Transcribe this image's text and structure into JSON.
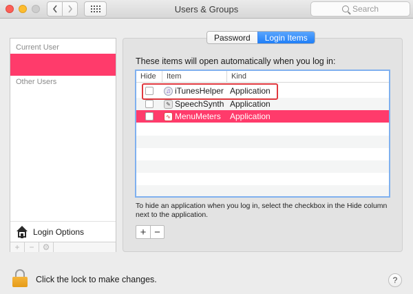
{
  "window": {
    "title": "Users & Groups",
    "search_placeholder": "Search",
    "back_icon": "chevron-left-icon",
    "forward_icon": "chevron-right-icon",
    "show_all_icon": "grid-icon"
  },
  "users_panel": {
    "current_user_header": "Current User",
    "other_users_header": "Other Users",
    "login_options_label": "Login Options",
    "footer_buttons": [
      "+",
      "−",
      "⚙"
    ]
  },
  "tabs": [
    {
      "label": "Password",
      "active": false
    },
    {
      "label": "Login Items",
      "active": true
    }
  ],
  "login_items": {
    "intro": "These items will open automatically when you log in:",
    "columns": {
      "hide": "Hide",
      "item": "Item",
      "kind": "Kind"
    },
    "rows": [
      {
        "name": "iTunesHelper",
        "kind": "Application",
        "hidden": false,
        "selected": false,
        "icon": "itunes-icon"
      },
      {
        "name": "SpeechSynth",
        "kind": "Application",
        "hidden": false,
        "selected": false,
        "icon": "speech-icon"
      },
      {
        "name": "MenuMeters",
        "kind": "Application",
        "hidden": false,
        "selected": true,
        "icon": "menumeters-icon"
      }
    ],
    "hint": "To hide an application when you log in, select the checkbox in the Hide column next to the application.",
    "add_label": "+",
    "remove_label": "−"
  },
  "footer": {
    "lock_text": "Click the lock to make changes.",
    "help_label": "?"
  },
  "colors": {
    "selection": "#ff3b6b",
    "tab_active": "#1e7ef7",
    "highlight_box": "#e0383e"
  }
}
